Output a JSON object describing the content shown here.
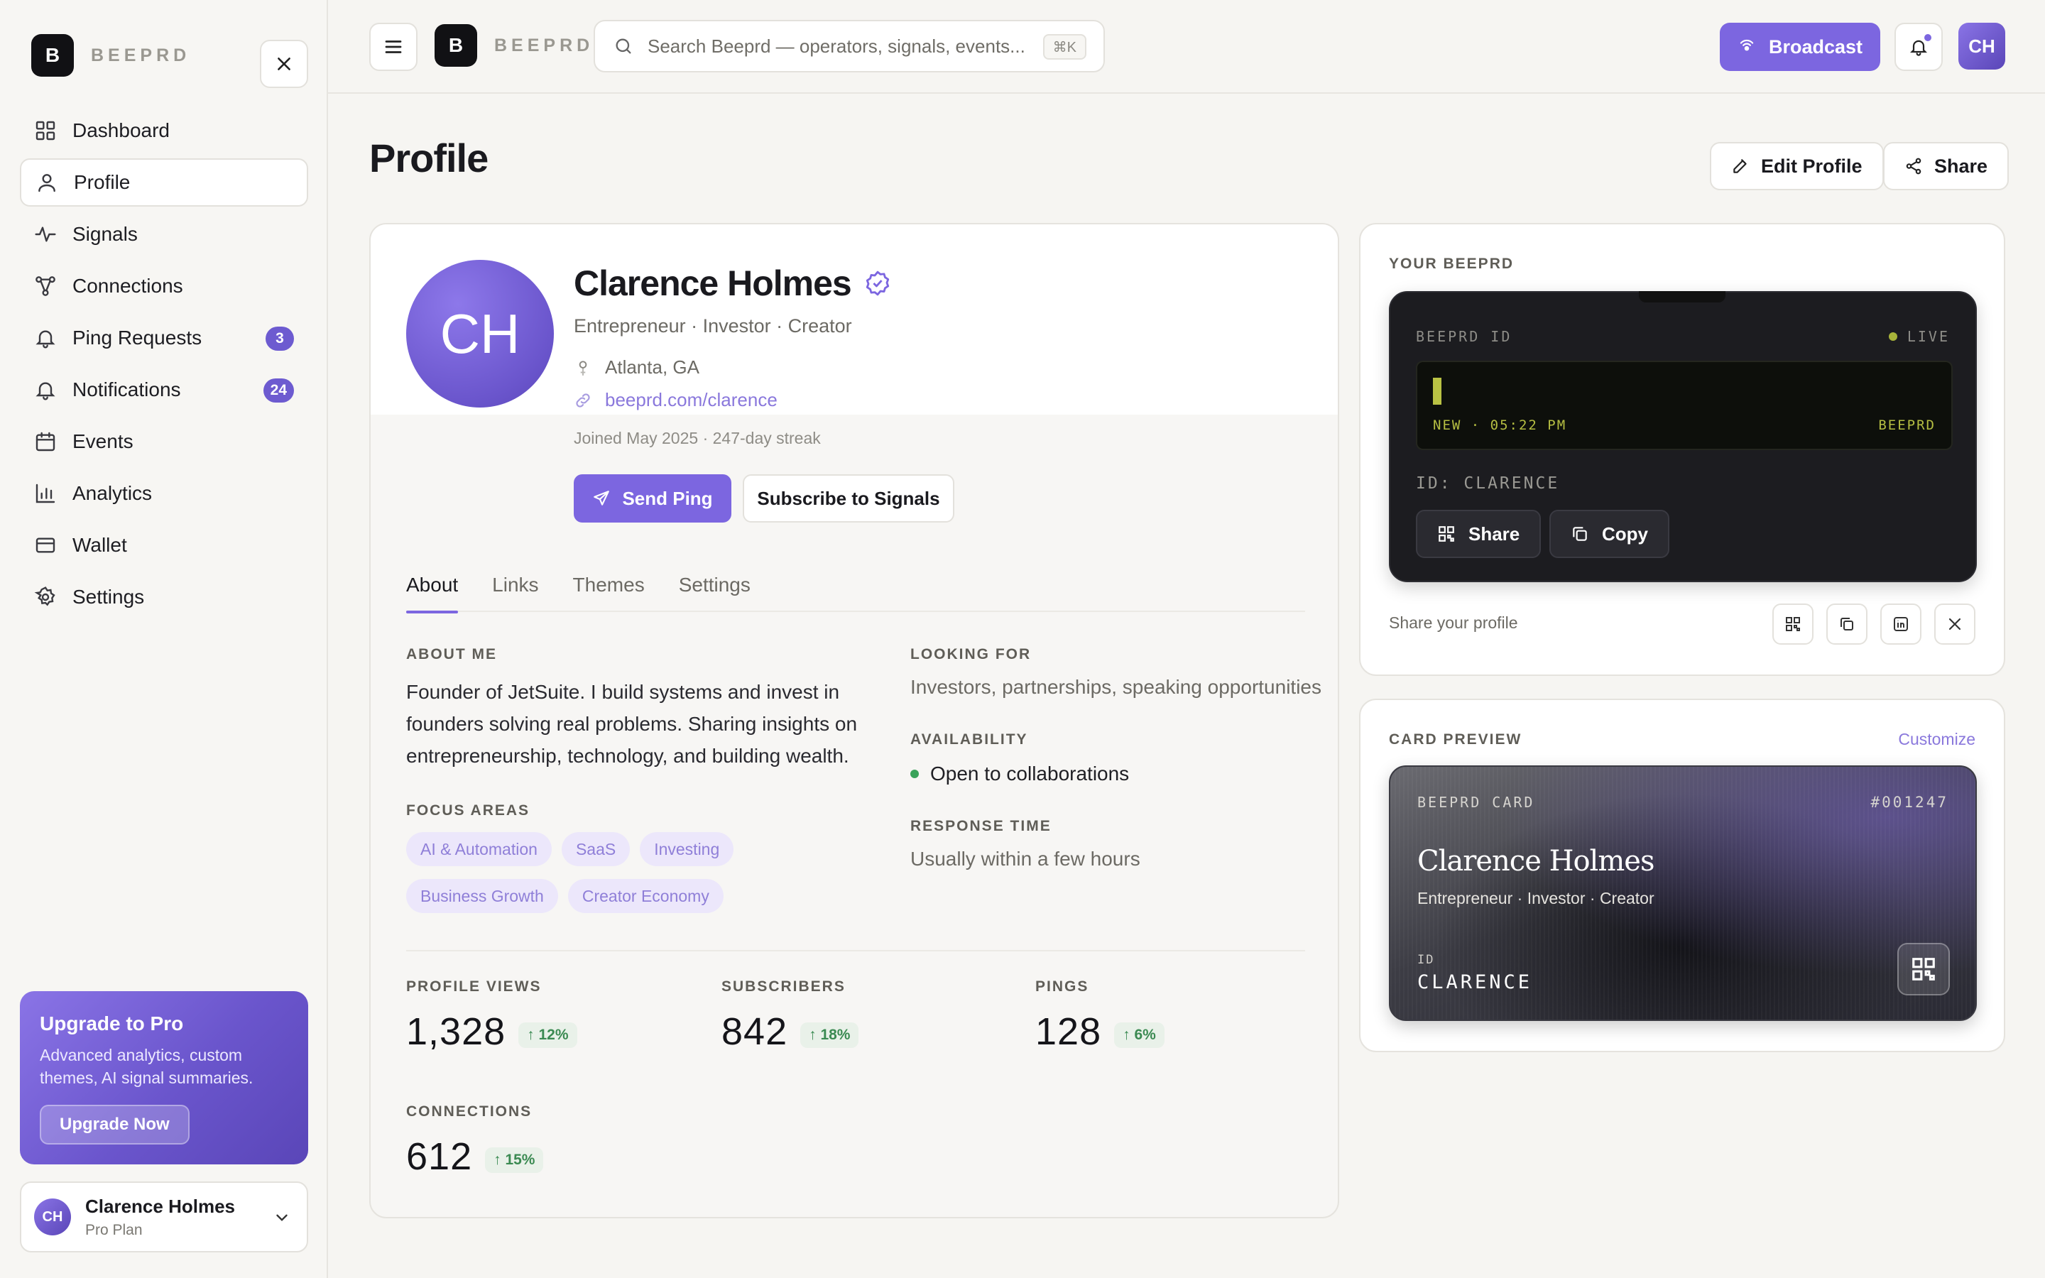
{
  "brand": {
    "logo_letter": "B",
    "name": "BEEPRD"
  },
  "sidebar": {
    "items": [
      {
        "label": "Dashboard",
        "icon": "grid-icon"
      },
      {
        "label": "Profile",
        "icon": "user-icon",
        "active": true
      },
      {
        "label": "Signals",
        "icon": "activity-icon"
      },
      {
        "label": "Connections",
        "icon": "network-icon"
      },
      {
        "label": "Ping Requests",
        "icon": "bell-icon",
        "badge": "3"
      },
      {
        "label": "Notifications",
        "icon": "bell-icon",
        "badge": "24"
      },
      {
        "label": "Events",
        "icon": "calendar-icon"
      },
      {
        "label": "Analytics",
        "icon": "bar-chart-icon"
      },
      {
        "label": "Wallet",
        "icon": "wallet-icon"
      },
      {
        "label": "Settings",
        "icon": "gear-icon"
      }
    ],
    "upgrade": {
      "title": "Upgrade to Pro",
      "description": "Advanced analytics, custom themes, AI signal summaries.",
      "button": "Upgrade Now"
    },
    "user": {
      "initials": "CH",
      "name": "Clarence Holmes",
      "plan": "Pro Plan"
    }
  },
  "topbar": {
    "search_placeholder": "Search Beeprd — operators, signals, events...",
    "shortcut": "⌘K",
    "broadcast_label": "Broadcast",
    "avatar_initials": "CH"
  },
  "page": {
    "title": "Profile",
    "edit_label": "Edit Profile",
    "share_label": "Share"
  },
  "profile": {
    "initials": "CH",
    "name": "Clarence Holmes",
    "title": "Entrepreneur · Investor · Creator",
    "location": "Atlanta, GA",
    "link": "beeprd.com/clarence",
    "joined": "Joined May 2025 · 247-day streak",
    "send_ping": "Send Ping",
    "subscribe": "Subscribe to Signals",
    "tabs": [
      "About",
      "Links",
      "Themes",
      "Settings"
    ],
    "about_label": "ABOUT ME",
    "about_text": "Founder of JetSuite. I build systems and invest in founders solving real problems. Sharing insights on entrepreneurship, technology, and building wealth.",
    "focus_label": "FOCUS AREAS",
    "focus_areas": [
      "AI & Automation",
      "SaaS",
      "Investing",
      "Business Growth",
      "Creator Economy"
    ],
    "looking_label": "LOOKING FOR",
    "looking_value": "Investors, partnerships, speaking opportunities",
    "availability_label": "AVAILABILITY",
    "availability_value": "Open to collaborations",
    "response_label": "RESPONSE TIME",
    "response_value": "Usually within a few hours",
    "stats": [
      {
        "label": "PROFILE VIEWS",
        "value": "1,328",
        "delta": "12%"
      },
      {
        "label": "SUBSCRIBERS",
        "value": "842",
        "delta": "18%"
      },
      {
        "label": "PINGS",
        "value": "128",
        "delta": "6%"
      },
      {
        "label": "CONNECTIONS",
        "value": "612",
        "delta": "15%"
      }
    ]
  },
  "beeprd_panel": {
    "label": "YOUR BEEPRD",
    "device_id_label": "BEEPRD ID",
    "live": "LIVE",
    "screen_left": "NEW · 05:22 PM",
    "screen_right": "BEEPRD",
    "uid": "ID: CLARENCE",
    "share": "Share",
    "copy": "Copy",
    "share_profile": "Share your profile"
  },
  "card_preview": {
    "label": "CARD PREVIEW",
    "customize": "Customize",
    "card_label": "BEEPRD CARD",
    "card_number": "#001247",
    "name": "Clarence Holmes",
    "title": "Entrepreneur · Investor · Creator",
    "id_label": "ID",
    "id_value": "CLARENCE"
  },
  "colors": {
    "accent": "#7c66e0",
    "success": "#3aa35a",
    "device": "#1c1c20"
  }
}
